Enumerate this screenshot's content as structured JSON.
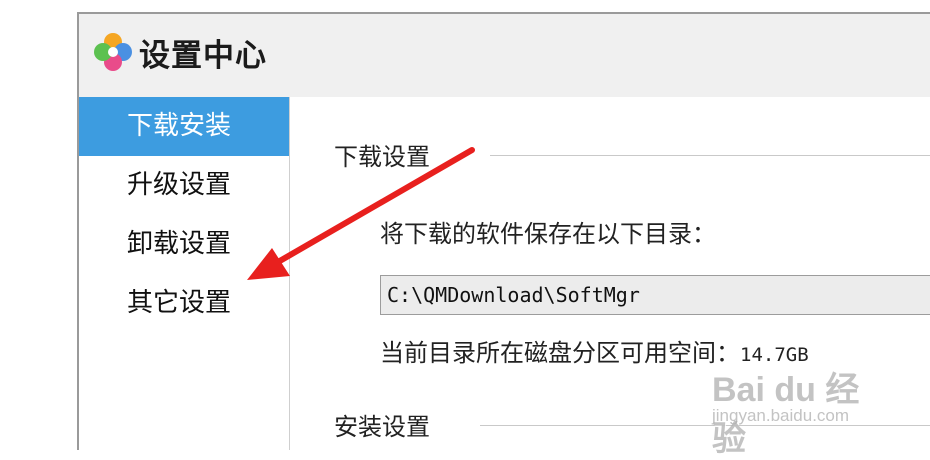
{
  "window": {
    "title": "设置中心"
  },
  "sidebar": {
    "items": [
      {
        "label": "下载安装",
        "active": true
      },
      {
        "label": "升级设置",
        "active": false
      },
      {
        "label": "卸载设置",
        "active": false
      },
      {
        "label": "其它设置",
        "active": false
      }
    ]
  },
  "download_section": {
    "heading": "下载设置",
    "save_dir_label": "将下载的软件保存在以下目录：",
    "save_dir_value": "C:\\QMDownload\\SoftMgr",
    "free_space_label": "当前目录所在磁盘分区可用空间：",
    "free_space_value": "14.7GB"
  },
  "install_section": {
    "heading": "安装设置"
  },
  "annotation": {
    "arrow_color": "#e8201e"
  },
  "watermark": {
    "logo": "Bai du 经验",
    "sub": "jingyan.baidu.com"
  },
  "colors": {
    "accent": "#3d9ce0",
    "window_bg": "#f0f0f0"
  }
}
